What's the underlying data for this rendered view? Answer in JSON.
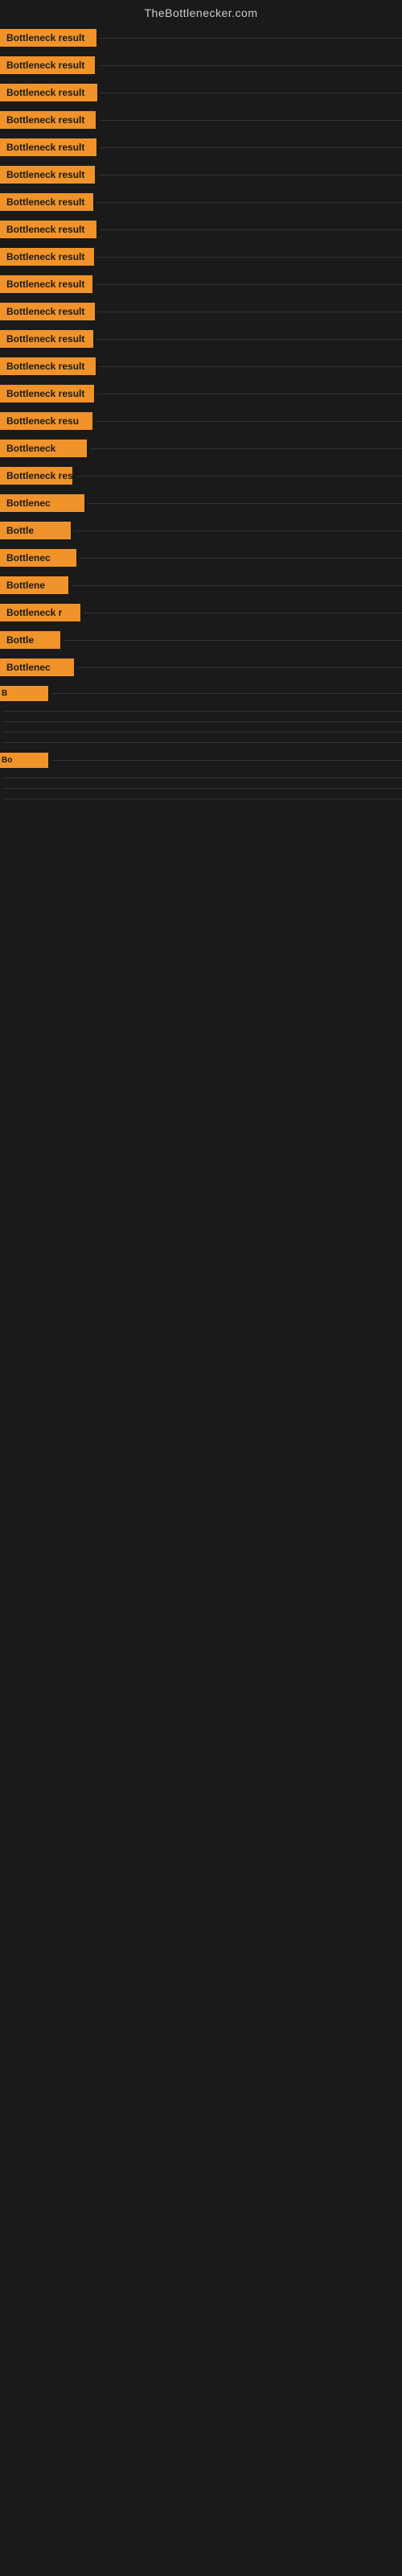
{
  "site": {
    "title": "TheBottlenecker.com"
  },
  "rows": [
    {
      "id": 1,
      "label": "Bottleneck result",
      "visible": true
    },
    {
      "id": 2,
      "label": "Bottleneck result",
      "visible": true
    },
    {
      "id": 3,
      "label": "Bottleneck result",
      "visible": true
    },
    {
      "id": 4,
      "label": "Bottleneck result",
      "visible": true
    },
    {
      "id": 5,
      "label": "Bottleneck result",
      "visible": true
    },
    {
      "id": 6,
      "label": "Bottleneck result",
      "visible": true
    },
    {
      "id": 7,
      "label": "Bottleneck result",
      "visible": true
    },
    {
      "id": 8,
      "label": "Bottleneck result",
      "visible": true
    },
    {
      "id": 9,
      "label": "Bottleneck result",
      "visible": true
    },
    {
      "id": 10,
      "label": "Bottleneck result",
      "visible": true
    },
    {
      "id": 11,
      "label": "Bottleneck result",
      "visible": true
    },
    {
      "id": 12,
      "label": "Bottleneck result",
      "visible": true
    },
    {
      "id": 13,
      "label": "Bottleneck result",
      "visible": true
    },
    {
      "id": 14,
      "label": "Bottleneck result",
      "visible": true
    },
    {
      "id": 15,
      "label": "Bottleneck resu",
      "visible": true
    },
    {
      "id": 16,
      "label": "Bottleneck",
      "visible": true
    },
    {
      "id": 17,
      "label": "Bottleneck res",
      "visible": true
    },
    {
      "id": 18,
      "label": "Bottlenec",
      "visible": true
    },
    {
      "id": 19,
      "label": "Bottle",
      "visible": true
    },
    {
      "id": 20,
      "label": "Bottlenec",
      "visible": true
    },
    {
      "id": 21,
      "label": "Bottlene",
      "visible": true
    },
    {
      "id": 22,
      "label": "Bottleneck r",
      "visible": true
    },
    {
      "id": 23,
      "label": "Bottle",
      "visible": true
    },
    {
      "id": 24,
      "label": "Bottlenec",
      "visible": true
    },
    {
      "id": 25,
      "label": "B",
      "visible": true
    },
    {
      "id": 26,
      "label": "",
      "visible": false
    },
    {
      "id": 27,
      "label": "",
      "visible": false
    },
    {
      "id": 28,
      "label": "",
      "visible": false
    },
    {
      "id": 29,
      "label": "",
      "visible": false
    },
    {
      "id": 30,
      "label": "Bo",
      "visible": true
    },
    {
      "id": 31,
      "label": "",
      "visible": false
    },
    {
      "id": 32,
      "label": "",
      "visible": false
    },
    {
      "id": 33,
      "label": "",
      "visible": false
    }
  ]
}
